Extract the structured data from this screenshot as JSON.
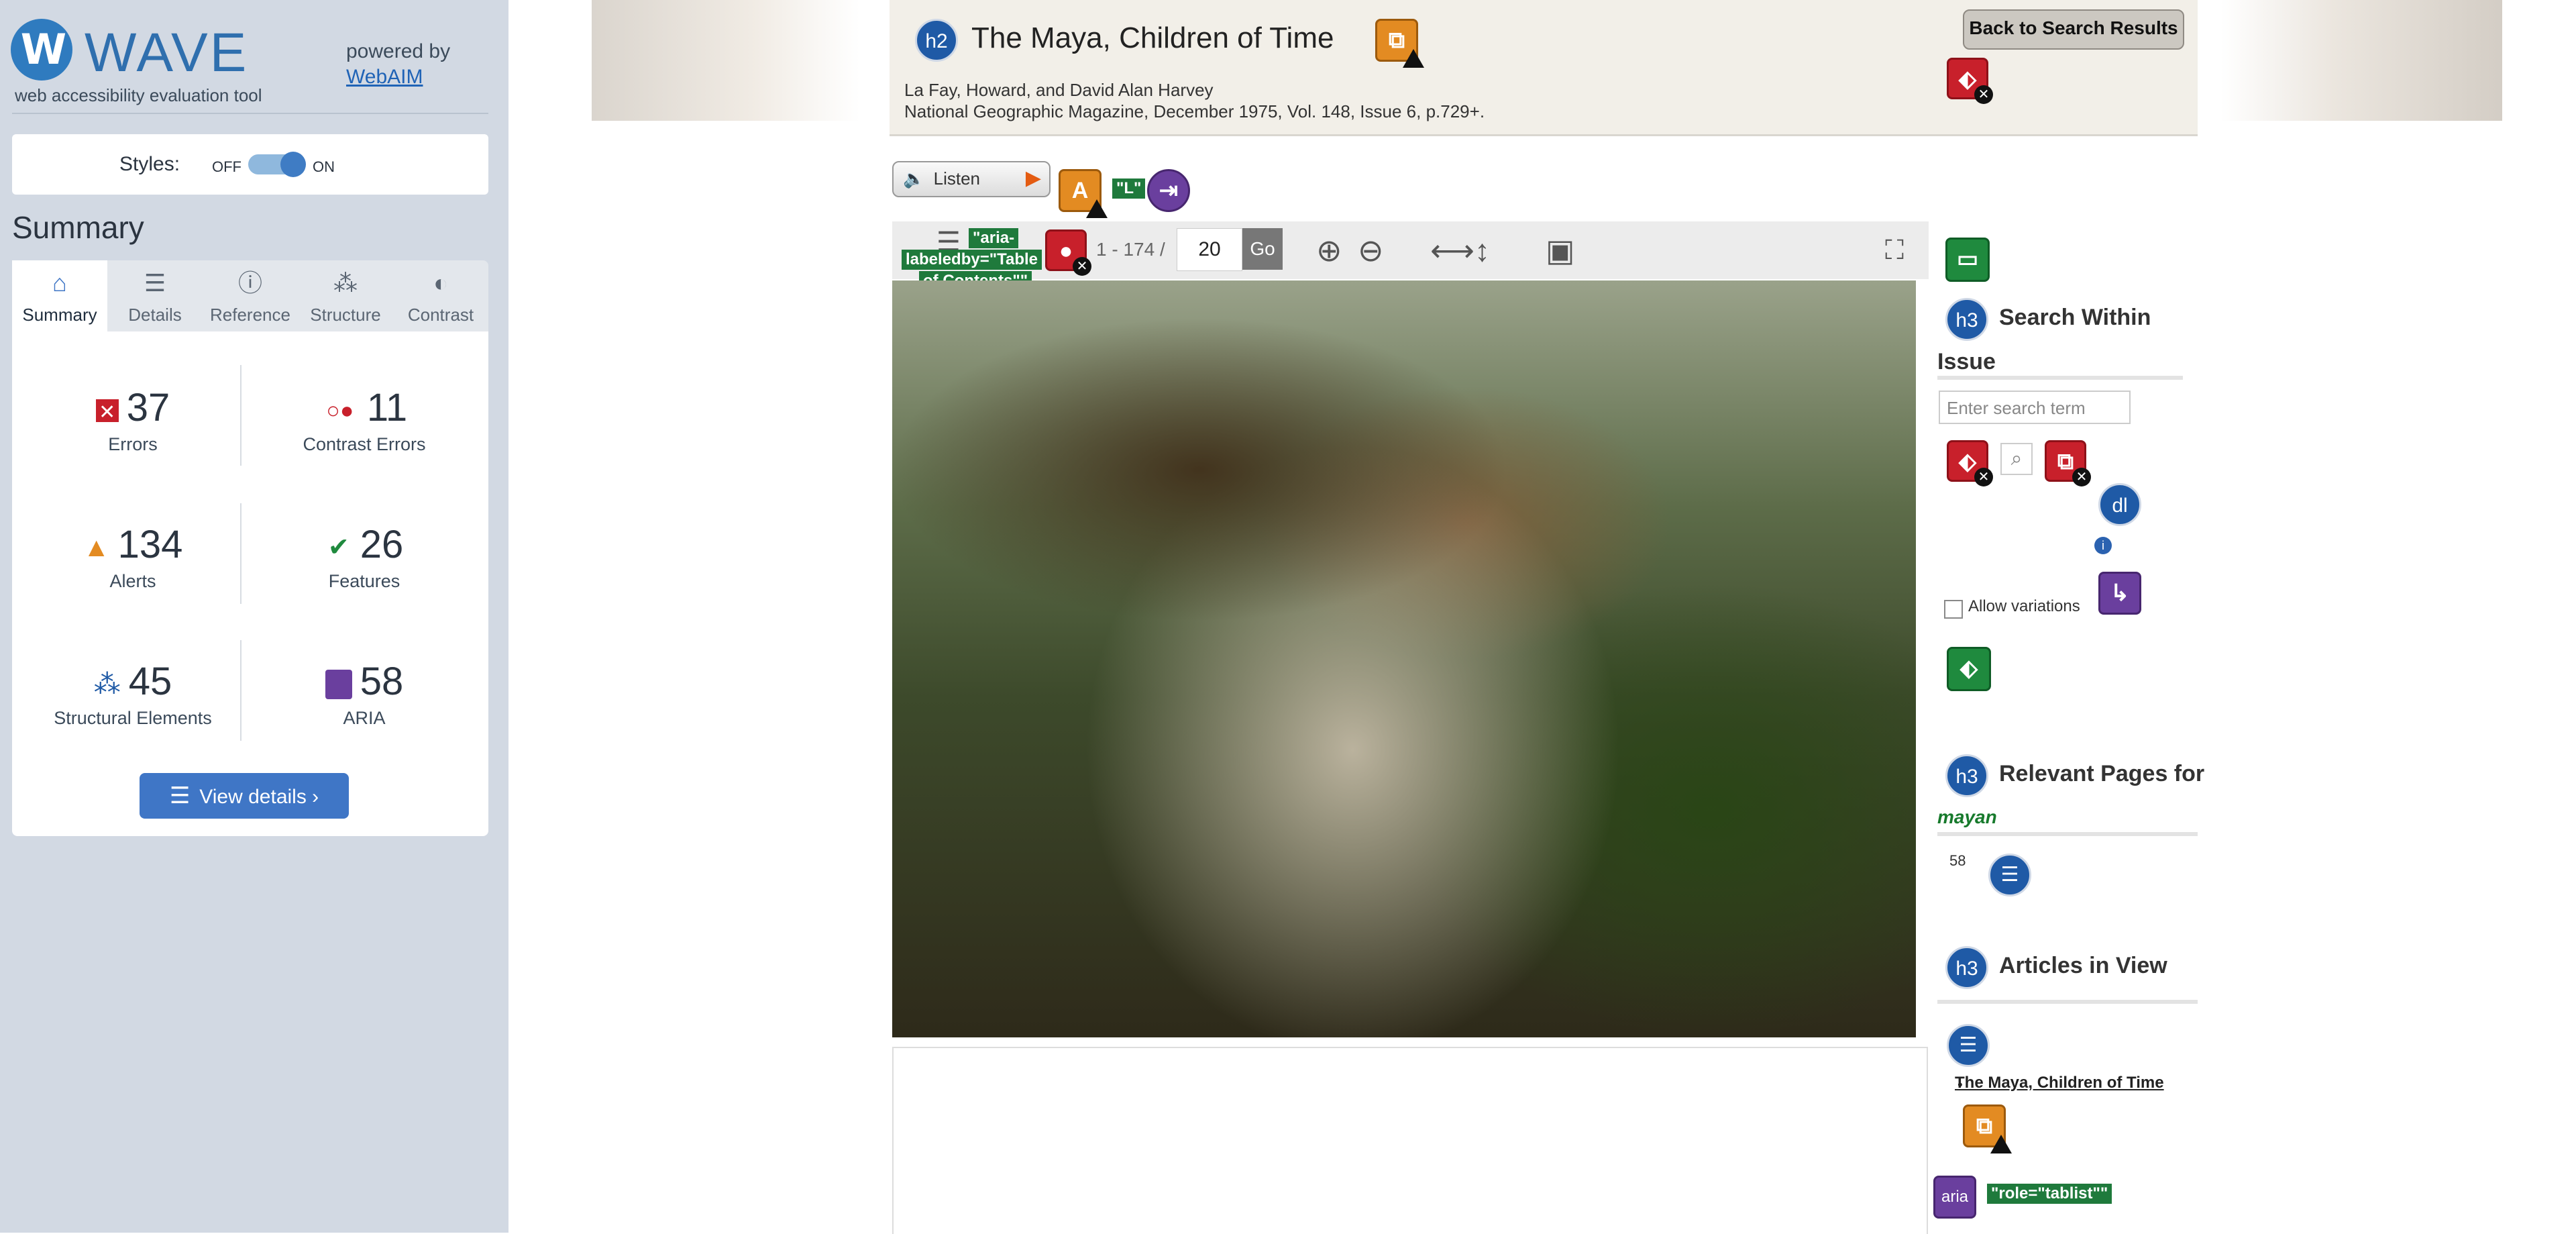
{
  "wave": {
    "logo_letter": "W",
    "logo_text": "WAVE",
    "tagline": "web accessibility evaluation tool",
    "powered_by": "powered by",
    "webaim": "WebAIM",
    "styles_label": "Styles:",
    "styles_off": "OFF",
    "styles_on": "ON",
    "summary_heading": "Summary",
    "tabs": [
      {
        "label": "Summary",
        "icon": "home-icon",
        "glyph": "⌂"
      },
      {
        "label": "Details",
        "icon": "list-icon",
        "glyph": "☰"
      },
      {
        "label": "Reference",
        "icon": "info-icon",
        "glyph": "ⓘ"
      },
      {
        "label": "Structure",
        "icon": "structure-icon",
        "glyph": "⁂"
      },
      {
        "label": "Contrast",
        "icon": "contrast-icon",
        "glyph": "◐"
      }
    ],
    "stats": [
      {
        "value": "37",
        "label": "Errors",
        "icon": "error-icon",
        "color": "#c8202b"
      },
      {
        "value": "11",
        "label": "Contrast Errors",
        "icon": "contrast-error-icon",
        "color": "#c8202b"
      },
      {
        "value": "134",
        "label": "Alerts",
        "icon": "alert-icon",
        "color": "#e38b22"
      },
      {
        "value": "26",
        "label": "Features",
        "icon": "feature-icon",
        "color": "#1f8a3e"
      },
      {
        "value": "45",
        "label": "Structural Elements",
        "icon": "structure-icon",
        "color": "#1f5aa6"
      },
      {
        "value": "58",
        "label": "ARIA",
        "icon": "aria-icon",
        "color": "#6a3f9e"
      }
    ],
    "view_details": "View details ›"
  },
  "page": {
    "h2_badge": "h2",
    "title": "The Maya, Children of Time",
    "byline_1": "La Fay, Howard, and David Alan Harvey",
    "byline_2": "National Geographic Magazine, December 1975, Vol. 148, Issue 6, p.729+.",
    "back_button": "Back to Search Results",
    "listen": "Listen",
    "toolbar": {
      "aria_label_1": "\"aria-",
      "aria_label_2": "labeledby=\"Table",
      "aria_label_3": "of Contents\"\"",
      "page_range": "1 - 174 /",
      "page_value": "20",
      "go": "Go"
    },
    "right": {
      "h3": "h3",
      "search_within": "Search Within",
      "issue": "Issue",
      "search_placeholder": "Enter search term",
      "dl_badge": "dl",
      "allow_variations": "Allow variations",
      "relevant_pages": "Relevant Pages for",
      "query": "mayan",
      "count": "58",
      "articles_in_view": "Articles in View",
      "article_link": "The Maya, Children of Time",
      "aria_badge": "aria",
      "role_tablist": "\"role=\"tablist\"\""
    }
  }
}
